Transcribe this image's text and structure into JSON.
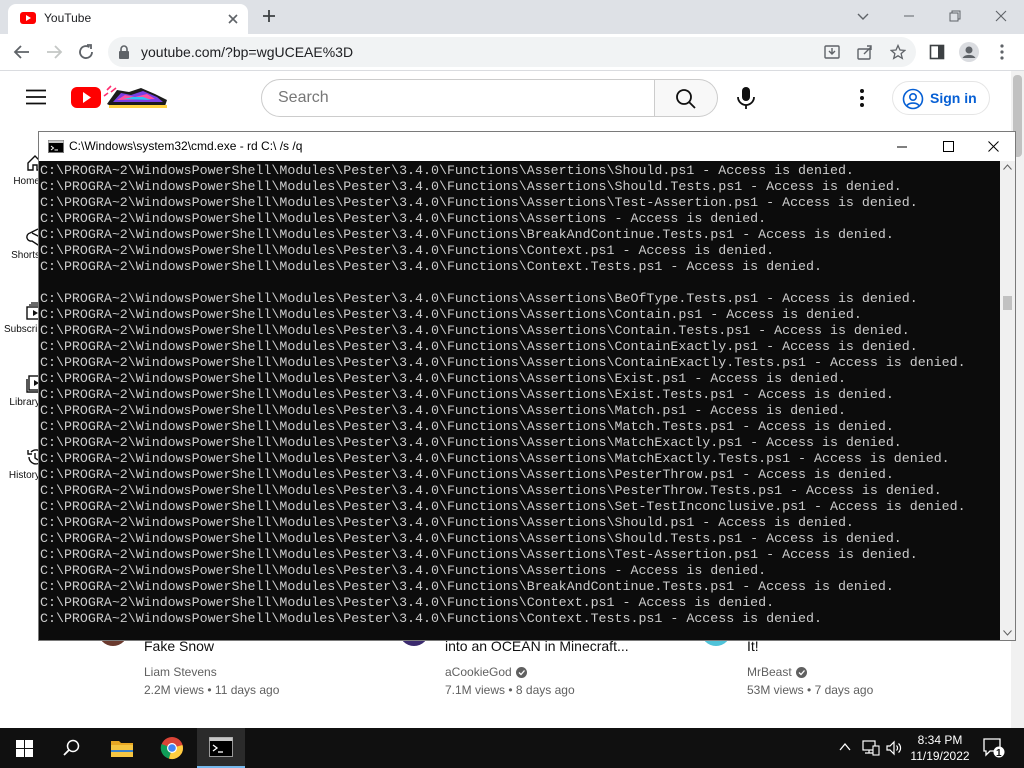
{
  "browser": {
    "tab_title": "YouTube",
    "url": "youtube.com/?bp=wgUCEAE%3D"
  },
  "youtube": {
    "search_placeholder": "Search",
    "signin_label": "Sign in",
    "sidebar": [
      {
        "label": "Home",
        "icon": "home-icon"
      },
      {
        "label": "Shorts",
        "icon": "shorts-icon"
      },
      {
        "label": "Subscriptions",
        "icon": "subscriptions-icon"
      },
      {
        "label": "Library",
        "icon": "library-icon"
      },
      {
        "label": "History",
        "icon": "history-icon"
      }
    ],
    "videos": [
      {
        "title": "Fake Snow",
        "channel": "Liam Stevens",
        "verified": false,
        "views": "2.2M views",
        "age": "11 days ago",
        "avatar_color": "#6b3a2e"
      },
      {
        "title": "into an OCEAN in Minecraft...",
        "channel": "aCookieGod",
        "verified": true,
        "views": "7.1M views",
        "age": "8 days ago",
        "avatar_color": "#3b2a6e"
      },
      {
        "title": "It!",
        "channel": "MrBeast",
        "verified": true,
        "views": "53M views",
        "age": "7 days ago",
        "avatar_color": "#4fc3d9"
      }
    ]
  },
  "cmd": {
    "title": "C:\\Windows\\system32\\cmd.exe - rd  C:\\ /s /q",
    "lines": [
      "C:\\PROGRA~2\\WindowsPowerShell\\Modules\\Pester\\3.4.0\\Functions\\Assertions\\Should.ps1 - Access is denied.",
      "C:\\PROGRA~2\\WindowsPowerShell\\Modules\\Pester\\3.4.0\\Functions\\Assertions\\Should.Tests.ps1 - Access is denied.",
      "C:\\PROGRA~2\\WindowsPowerShell\\Modules\\Pester\\3.4.0\\Functions\\Assertions\\Test-Assertion.ps1 - Access is denied.",
      "C:\\PROGRA~2\\WindowsPowerShell\\Modules\\Pester\\3.4.0\\Functions\\Assertions - Access is denied.",
      "C:\\PROGRA~2\\WindowsPowerShell\\Modules\\Pester\\3.4.0\\Functions\\BreakAndContinue.Tests.ps1 - Access is denied.",
      "C:\\PROGRA~2\\WindowsPowerShell\\Modules\\Pester\\3.4.0\\Functions\\Context.ps1 - Access is denied.",
      "C:\\PROGRA~2\\WindowsPowerShell\\Modules\\Pester\\3.4.0\\Functions\\Context.Tests.ps1 - Access is denied.",
      "",
      "C:\\PROGRA~2\\WindowsPowerShell\\Modules\\Pester\\3.4.0\\Functions\\Assertions\\BeOfType.Tests.ps1 - Access is denied.",
      "C:\\PROGRA~2\\WindowsPowerShell\\Modules\\Pester\\3.4.0\\Functions\\Assertions\\Contain.ps1 - Access is denied.",
      "C:\\PROGRA~2\\WindowsPowerShell\\Modules\\Pester\\3.4.0\\Functions\\Assertions\\Contain.Tests.ps1 - Access is denied.",
      "C:\\PROGRA~2\\WindowsPowerShell\\Modules\\Pester\\3.4.0\\Functions\\Assertions\\ContainExactly.ps1 - Access is denied.",
      "C:\\PROGRA~2\\WindowsPowerShell\\Modules\\Pester\\3.4.0\\Functions\\Assertions\\ContainExactly.Tests.ps1 - Access is denied.",
      "C:\\PROGRA~2\\WindowsPowerShell\\Modules\\Pester\\3.4.0\\Functions\\Assertions\\Exist.ps1 - Access is denied.",
      "C:\\PROGRA~2\\WindowsPowerShell\\Modules\\Pester\\3.4.0\\Functions\\Assertions\\Exist.Tests.ps1 - Access is denied.",
      "C:\\PROGRA~2\\WindowsPowerShell\\Modules\\Pester\\3.4.0\\Functions\\Assertions\\Match.ps1 - Access is denied.",
      "C:\\PROGRA~2\\WindowsPowerShell\\Modules\\Pester\\3.4.0\\Functions\\Assertions\\Match.Tests.ps1 - Access is denied.",
      "C:\\PROGRA~2\\WindowsPowerShell\\Modules\\Pester\\3.4.0\\Functions\\Assertions\\MatchExactly.ps1 - Access is denied.",
      "C:\\PROGRA~2\\WindowsPowerShell\\Modules\\Pester\\3.4.0\\Functions\\Assertions\\MatchExactly.Tests.ps1 - Access is denied.",
      "C:\\PROGRA~2\\WindowsPowerShell\\Modules\\Pester\\3.4.0\\Functions\\Assertions\\PesterThrow.ps1 - Access is denied.",
      "C:\\PROGRA~2\\WindowsPowerShell\\Modules\\Pester\\3.4.0\\Functions\\Assertions\\PesterThrow.Tests.ps1 - Access is denied.",
      "C:\\PROGRA~2\\WindowsPowerShell\\Modules\\Pester\\3.4.0\\Functions\\Assertions\\Set-TestInconclusive.ps1 - Access is denied.",
      "C:\\PROGRA~2\\WindowsPowerShell\\Modules\\Pester\\3.4.0\\Functions\\Assertions\\Should.ps1 - Access is denied.",
      "C:\\PROGRA~2\\WindowsPowerShell\\Modules\\Pester\\3.4.0\\Functions\\Assertions\\Should.Tests.ps1 - Access is denied.",
      "C:\\PROGRA~2\\WindowsPowerShell\\Modules\\Pester\\3.4.0\\Functions\\Assertions\\Test-Assertion.ps1 - Access is denied.",
      "C:\\PROGRA~2\\WindowsPowerShell\\Modules\\Pester\\3.4.0\\Functions\\Assertions - Access is denied.",
      "C:\\PROGRA~2\\WindowsPowerShell\\Modules\\Pester\\3.4.0\\Functions\\BreakAndContinue.Tests.ps1 - Access is denied.",
      "C:\\PROGRA~2\\WindowsPowerShell\\Modules\\Pester\\3.4.0\\Functions\\Context.ps1 - Access is denied.",
      "C:\\PROGRA~2\\WindowsPowerShell\\Modules\\Pester\\3.4.0\\Functions\\Context.Tests.ps1 - Access is denied."
    ]
  },
  "taskbar": {
    "apps": [
      {
        "icon": "windows-start-icon"
      },
      {
        "icon": "search-icon"
      },
      {
        "icon": "file-explorer-icon"
      },
      {
        "icon": "chrome-icon"
      },
      {
        "icon": "cmd-icon"
      }
    ],
    "time": "8:34 PM",
    "date": "11/19/2022",
    "notification_count": "1"
  },
  "colors": {
    "youtube_red": "#ff0000",
    "link_blue": "#065fd4",
    "console_bg": "#0c0c0c",
    "console_text": "#cccccc",
    "taskbar_bg": "#101010",
    "tab_strip": "#dee1e6"
  }
}
